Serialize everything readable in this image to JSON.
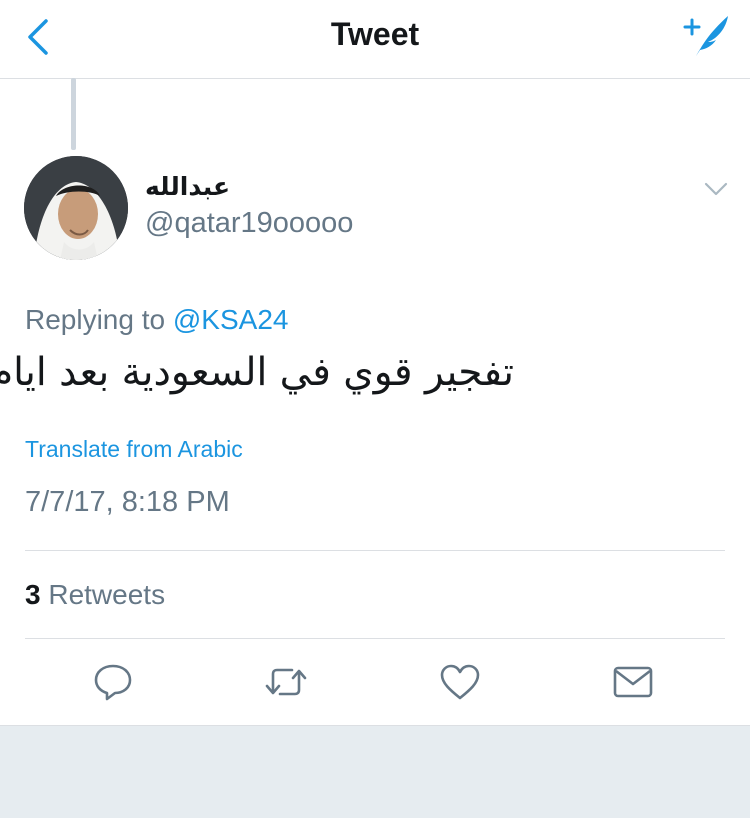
{
  "navbar": {
    "title": "Tweet",
    "back_icon": "chevron-left-icon",
    "compose_icon": "compose-feather-icon",
    "accent_color": "#1b95e0"
  },
  "tweet": {
    "display_name": "عبدالله",
    "handle": "@qatar19ooooo",
    "replying_prefix": "Replying to",
    "replying_to": "@KSA24",
    "text": "تفجير قوي في السعودية بعد ايام",
    "translate_label": "Translate from Arabic",
    "timestamp": "7/7/17, 8:18 PM"
  },
  "stats": {
    "retweet_count": "3",
    "retweet_label": "Retweets"
  },
  "actions": [
    {
      "icon": "reply-icon"
    },
    {
      "icon": "retweet-icon"
    },
    {
      "icon": "like-heart-icon"
    },
    {
      "icon": "direct-message-icon"
    }
  ],
  "colors": {
    "text_primary": "#14171a",
    "text_secondary": "#657786",
    "link": "#1b95e0",
    "divider": "#dcdfe3",
    "background_footer": "#e6ecf0"
  }
}
